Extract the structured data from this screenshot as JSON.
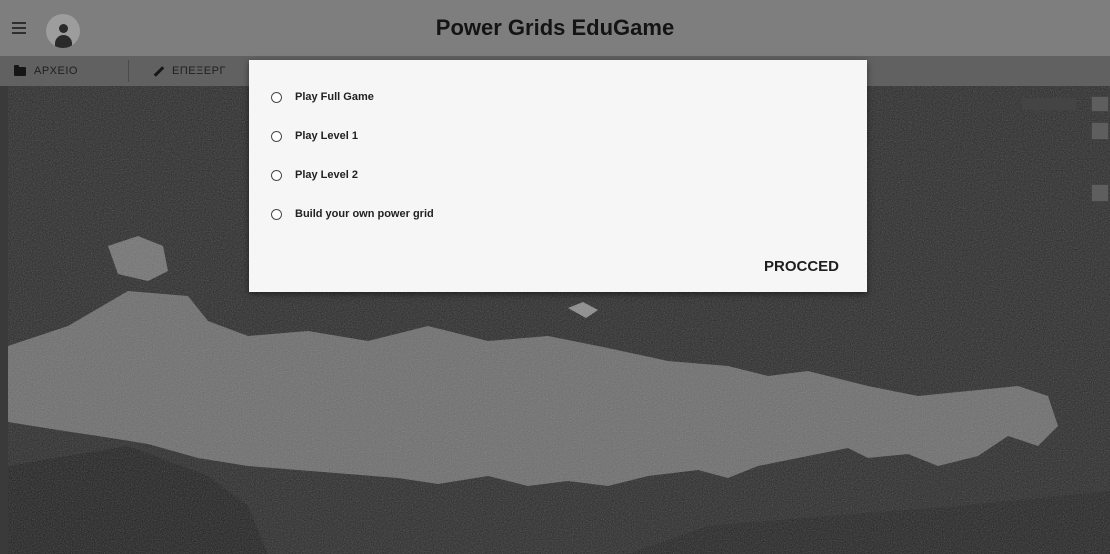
{
  "header": {
    "title": "Power Grids EduGame"
  },
  "toolbar": {
    "file_label": "ΑΡΧΕΙΟ",
    "edit_label": "ΕΠΕΞΕΡΓ"
  },
  "dialog": {
    "options": [
      {
        "label": "Play Full Game",
        "selected": false
      },
      {
        "label": "Play Level 1",
        "selected": false
      },
      {
        "label": "Play Level 2",
        "selected": false
      },
      {
        "label": "Build your own power grid",
        "selected": false
      }
    ],
    "proceed_label": "PROCCED"
  },
  "icons": [
    "menu-icon",
    "avatar-icon",
    "folder-icon",
    "pencil-icon"
  ]
}
